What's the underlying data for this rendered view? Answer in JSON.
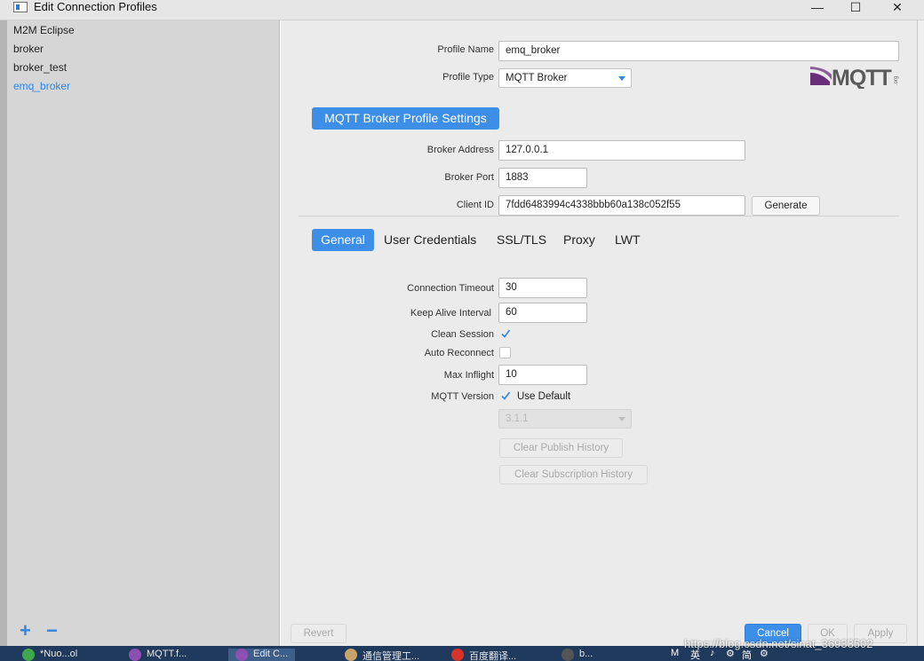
{
  "window": {
    "title": "Edit Connection Profiles",
    "minimize": "—",
    "maximize": "☐",
    "close": "✕"
  },
  "sidebar": {
    "items": [
      {
        "label": "M2M Eclipse",
        "active": false
      },
      {
        "label": "broker",
        "active": false
      },
      {
        "label": "broker_test",
        "active": false
      },
      {
        "label": "emq_broker",
        "active": true
      }
    ],
    "add_label": "+",
    "remove_label": "−"
  },
  "profile": {
    "name_label": "Profile Name",
    "name_value": "emq_broker",
    "type_label": "Profile Type",
    "type_value": "MQTT Broker",
    "logo_text": "MQTT",
    "logo_sub": ".org"
  },
  "broker": {
    "section_title": "MQTT Broker Profile Settings",
    "address_label": "Broker Address",
    "address_value": "127.0.0.1",
    "port_label": "Broker Port",
    "port_value": "1883",
    "client_id_label": "Client ID",
    "client_id_value": "7fdd6483994c4338bbb60a138c052f55",
    "generate_label": "Generate"
  },
  "tabs": [
    {
      "label": "General",
      "active": true
    },
    {
      "label": "User Credentials",
      "active": false
    },
    {
      "label": "SSL/TLS",
      "active": false
    },
    {
      "label": "Proxy",
      "active": false
    },
    {
      "label": "LWT",
      "active": false
    }
  ],
  "general": {
    "timeout_label": "Connection Timeout",
    "timeout_value": "30",
    "keepalive_label": "Keep Alive Interval",
    "keepalive_value": "60",
    "clean_session_label": "Clean Session",
    "clean_session": true,
    "auto_reconnect_label": "Auto Reconnect",
    "auto_reconnect": false,
    "max_inflight_label": "Max Inflight",
    "max_inflight_value": "10",
    "mqtt_version_label": "MQTT Version",
    "use_default_label": "Use Default",
    "use_default": true,
    "version_value": "3.1.1",
    "clear_publish_label": "Clear Publish History",
    "clear_subscription_label": "Clear Subscription History"
  },
  "footer": {
    "revert_label": "Revert",
    "cancel_label": "Cancel",
    "ok_label": "OK",
    "apply_label": "Apply"
  },
  "taskbar": {
    "items": [
      {
        "label": "*Nuo...ol"
      },
      {
        "label": "MQTT.f..."
      },
      {
        "label": "Edit C..."
      },
      {
        "label": "通信管理工..."
      },
      {
        "label": "百度翻译..."
      },
      {
        "label": "b..."
      }
    ],
    "tray": [
      "M",
      "英",
      "♪",
      "⚙",
      "简",
      "⚙"
    ]
  },
  "watermark": "https://blog.csdn.net/sinat_36933502",
  "colors": {
    "accent": "#3d8ee6",
    "sidebar_bg": "#d6d6d6",
    "main_bg": "#ebebeb",
    "taskbar_bg": "#1f3a5c",
    "logo_purple": "#6a2d7a"
  }
}
